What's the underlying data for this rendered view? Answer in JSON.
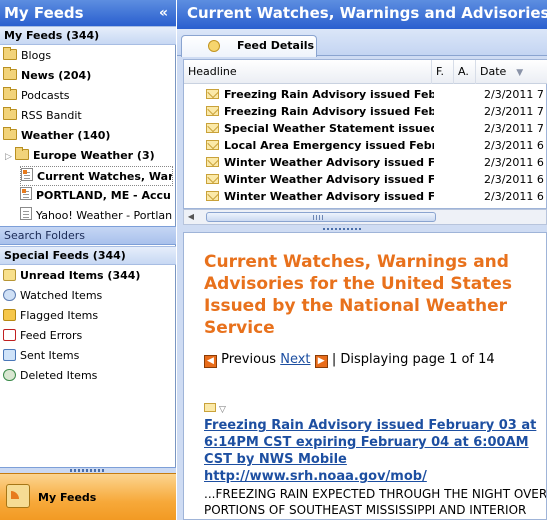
{
  "left_pane": {
    "header_title": "My Feeds",
    "collapse_glyph": "«",
    "my_feeds_group": "My Feeds  (344)",
    "tree": [
      {
        "label": "Blogs",
        "icon": "folder-icon"
      },
      {
        "label": "News  (204)",
        "icon": "folder-icon"
      },
      {
        "label": "Podcasts",
        "icon": "folder-icon"
      },
      {
        "label": "RSS Bandit",
        "icon": "folder-icon"
      },
      {
        "label": "Weather  (140)",
        "icon": "folder-icon"
      },
      {
        "label": "Europe Weather  (3)",
        "icon": "folder-icon"
      },
      {
        "label": "Current Watches, Warni",
        "icon": "feed-icon"
      },
      {
        "label": "PORTLAND, ME - Accu",
        "icon": "feed-icon"
      },
      {
        "label": "Yahoo! Weather - Portlan",
        "icon": "feed-icon"
      }
    ],
    "search_folders_label": "Search Folders",
    "special_feeds_group": "Special Feeds  (344)",
    "special": [
      {
        "label": "Unread Items  (344)",
        "icon": "unread-envelope-icon"
      },
      {
        "label": "Watched Items",
        "icon": "watched-glasses-icon"
      },
      {
        "label": "Flagged Items",
        "icon": "flag-icon"
      },
      {
        "label": "Feed Errors",
        "icon": "feed-error-icon"
      },
      {
        "label": "Sent Items",
        "icon": "sent-items-icon"
      },
      {
        "label": "Deleted Items",
        "icon": "deleted-items-icon"
      }
    ],
    "bottom_button": "My Feeds"
  },
  "right_pane": {
    "title": "Current Watches, Warnings and Advisories...",
    "tab_label": "Feed Details",
    "columns": {
      "headline": "Headline",
      "flag": "F.",
      "attach": "A.",
      "date": "Date"
    },
    "rows": [
      {
        "headline": "Freezing Rain Advisory issued Feb...",
        "date": "2/3/2011 7"
      },
      {
        "headline": "Freezing Rain Advisory issued Feb...",
        "date": "2/3/2011 7"
      },
      {
        "headline": "Special Weather Statement issued...",
        "date": "2/3/2011 7"
      },
      {
        "headline": "Local Area Emergency issued Febr...",
        "date": "2/3/2011 6"
      },
      {
        "headline": "Winter Weather Advisory issued F...",
        "date": "2/3/2011 6"
      },
      {
        "headline": "Winter Weather Advisory issued F...",
        "date": "2/3/2011 6"
      },
      {
        "headline": "Winter Weather Advisory issued F...",
        "date": "2/3/2011 6"
      }
    ],
    "reader": {
      "headline": "Current Watches, Warnings and Advisories for the United States Issued by the National Weather Service",
      "prev_label": "Previous",
      "next_label": "Next",
      "page_info": " | Displaying page 1 of 14",
      "item_title": "Freezing Rain Advisory issued February 03 at 6:14PM CST expiring February 04 at 6:00AM CST by NWS Mobile",
      "item_link": "http://www.srh.noaa.gov/mob/",
      "item_body": "...FREEZING RAIN EXPECTED THROUGH THE NIGHT OVER PORTIONS OF SOUTHEAST MISSISSIPPI AND INTERIOR SOUTHWEST ALABAMA... W"
    }
  }
}
